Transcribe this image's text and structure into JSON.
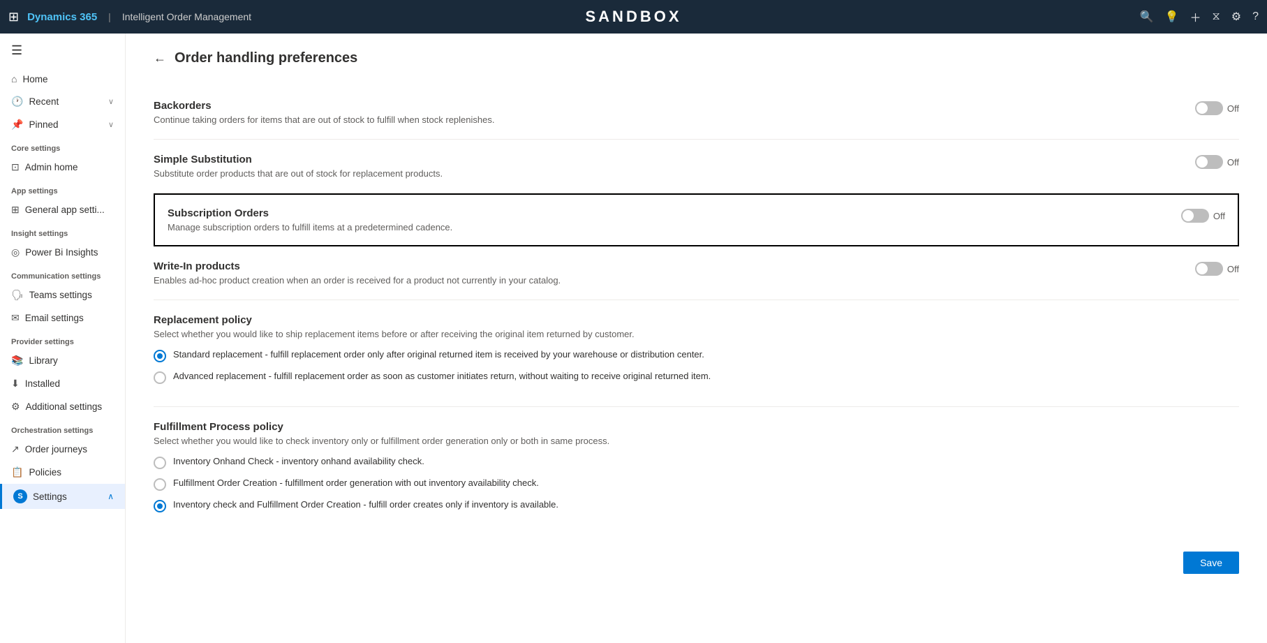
{
  "topbar": {
    "app_name": "Dynamics 365",
    "separator": "|",
    "module_name": "Intelligent Order Management",
    "sandbox_label": "SANDBOX",
    "icons": [
      "search",
      "lightbulb",
      "plus",
      "filter",
      "settings",
      "help"
    ]
  },
  "sidebar": {
    "hamburger": "☰",
    "nav_items": [
      {
        "id": "home",
        "icon": "⌂",
        "label": "Home",
        "has_chevron": false
      },
      {
        "id": "recent",
        "icon": "🕐",
        "label": "Recent",
        "has_chevron": true
      },
      {
        "id": "pinned",
        "icon": "📌",
        "label": "Pinned",
        "has_chevron": true
      }
    ],
    "sections": [
      {
        "header": "Core settings",
        "items": [
          {
            "id": "admin-home",
            "icon": "⊡",
            "label": "Admin home"
          }
        ]
      },
      {
        "header": "App settings",
        "items": [
          {
            "id": "general-app",
            "icon": "⊞",
            "label": "General app setti..."
          }
        ]
      },
      {
        "header": "Insight settings",
        "items": [
          {
            "id": "power-bi",
            "icon": "◎",
            "label": "Power Bi Insights"
          }
        ]
      },
      {
        "header": "Communication settings",
        "items": [
          {
            "id": "teams",
            "icon": "🗣",
            "label": "Teams settings"
          },
          {
            "id": "email",
            "icon": "✉",
            "label": "Email settings"
          }
        ]
      },
      {
        "header": "Provider settings",
        "items": [
          {
            "id": "library",
            "icon": "📚",
            "label": "Library"
          },
          {
            "id": "installed",
            "icon": "⬇",
            "label": "Installed"
          },
          {
            "id": "additional",
            "icon": "⚙",
            "label": "Additional settings"
          }
        ]
      },
      {
        "header": "Orchestration settings",
        "items": [
          {
            "id": "order-journeys",
            "icon": "↗",
            "label": "Order journeys"
          },
          {
            "id": "policies",
            "icon": "📋",
            "label": "Policies"
          }
        ]
      }
    ],
    "bottom_item": {
      "icon": "S",
      "label": "Settings",
      "chevron": "⌃"
    }
  },
  "page": {
    "back_arrow": "←",
    "title": "Order handling preferences",
    "settings": [
      {
        "id": "backorders",
        "title": "Backorders",
        "desc": "Continue taking orders for items that are out of stock to fulfill when stock replenishes.",
        "toggle_state": false,
        "toggle_label": "Off",
        "highlighted": false
      },
      {
        "id": "simple-substitution",
        "title": "Simple Substitution",
        "desc": "Substitute order products that are out of stock for replacement products.",
        "toggle_state": false,
        "toggle_label": "Off",
        "highlighted": false
      },
      {
        "id": "subscription-orders",
        "title": "Subscription Orders",
        "desc": "Manage subscription orders to fulfill items at a predetermined cadence.",
        "toggle_state": false,
        "toggle_label": "Off",
        "highlighted": true
      },
      {
        "id": "write-in-products",
        "title": "Write-In products",
        "desc": "Enables ad-hoc product creation when an order is received for a product not currently in your catalog.",
        "toggle_state": false,
        "toggle_label": "Off",
        "highlighted": false
      }
    ],
    "replacement_policy": {
      "title": "Replacement policy",
      "desc": "Select whether you would like to ship replacement items before or after receiving the original item returned by customer.",
      "options": [
        {
          "id": "standard-replacement",
          "label": "Standard replacement - fulfill replacement order only after original returned item is received by your warehouse or distribution center.",
          "selected": true
        },
        {
          "id": "advanced-replacement",
          "label": "Advanced replacement - fulfill replacement order as soon as customer initiates return, without waiting to receive original returned item.",
          "selected": false
        }
      ]
    },
    "fulfillment_policy": {
      "title": "Fulfillment Process policy",
      "desc": "Select whether you would like to check inventory only or fulfillment order generation only or both in same process.",
      "options": [
        {
          "id": "inventory-onhand",
          "label": "Inventory Onhand Check - inventory onhand availability check.",
          "selected": false
        },
        {
          "id": "fulfillment-order-creation",
          "label": "Fulfillment Order Creation - fulfillment order generation with out inventory availability check.",
          "selected": false
        },
        {
          "id": "inventory-check-and-fulfillment",
          "label": "Inventory check and Fulfillment Order Creation - fulfill order creates only if inventory is available.",
          "selected": true
        }
      ]
    },
    "save_button_label": "Save"
  }
}
